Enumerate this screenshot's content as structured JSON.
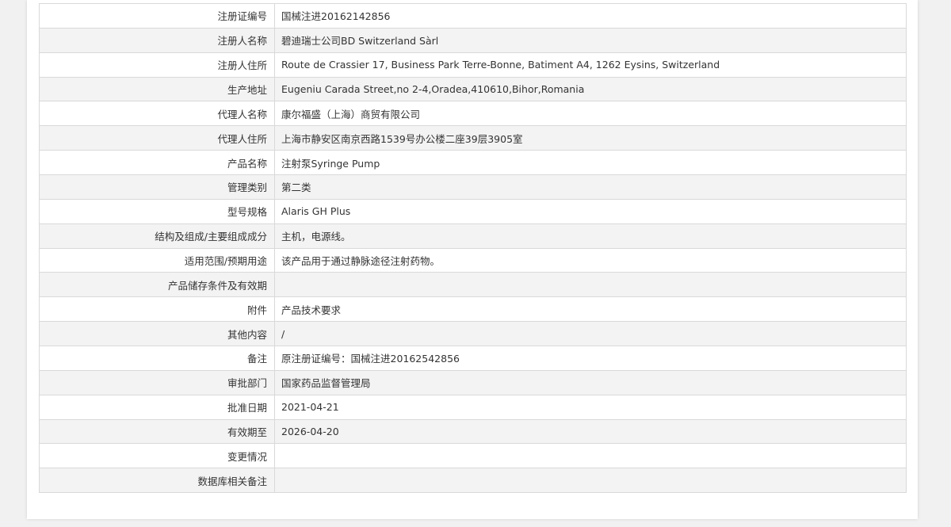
{
  "rows": [
    {
      "label": "注册证编号",
      "value": "国械注进20162142856"
    },
    {
      "label": "注册人名称",
      "value": "碧迪瑞士公司BD Switzerland Sàrl"
    },
    {
      "label": "注册人住所",
      "value": "Route de Crassier 17, Business Park Terre-Bonne, Batiment A4, 1262 Eysins, Switzerland"
    },
    {
      "label": "生产地址",
      "value": "Eugeniu Carada Street,no 2-4,Oradea,410610,Bihor,Romania"
    },
    {
      "label": "代理人名称",
      "value": "康尔福盛（上海）商贸有限公司"
    },
    {
      "label": "代理人住所",
      "value": "上海市静安区南京西路1539号办公楼二座39层3905室"
    },
    {
      "label": "产品名称",
      "value": "注射泵Syringe Pump"
    },
    {
      "label": "管理类别",
      "value": "第二类"
    },
    {
      "label": "型号规格",
      "value": "Alaris GH Plus"
    },
    {
      "label": "结构及组成/主要组成成分",
      "value": "主机，电源线。"
    },
    {
      "label": "适用范围/预期用途",
      "value": "该产品用于通过静脉途径注射药物。"
    },
    {
      "label": "产品储存条件及有效期",
      "value": ""
    },
    {
      "label": "附件",
      "value": "产品技术要求"
    },
    {
      "label": "其他内容",
      "value": "/"
    },
    {
      "label": "备注",
      "value": "原注册证编号：国械注进20162542856"
    },
    {
      "label": "审批部门",
      "value": "国家药品监督管理局"
    },
    {
      "label": "批准日期",
      "value": "2021-04-21"
    },
    {
      "label": "有效期至",
      "value": "2026-04-20"
    },
    {
      "label": "变更情况",
      "value": ""
    },
    {
      "label": "数据库相关备注",
      "value": ""
    }
  ]
}
